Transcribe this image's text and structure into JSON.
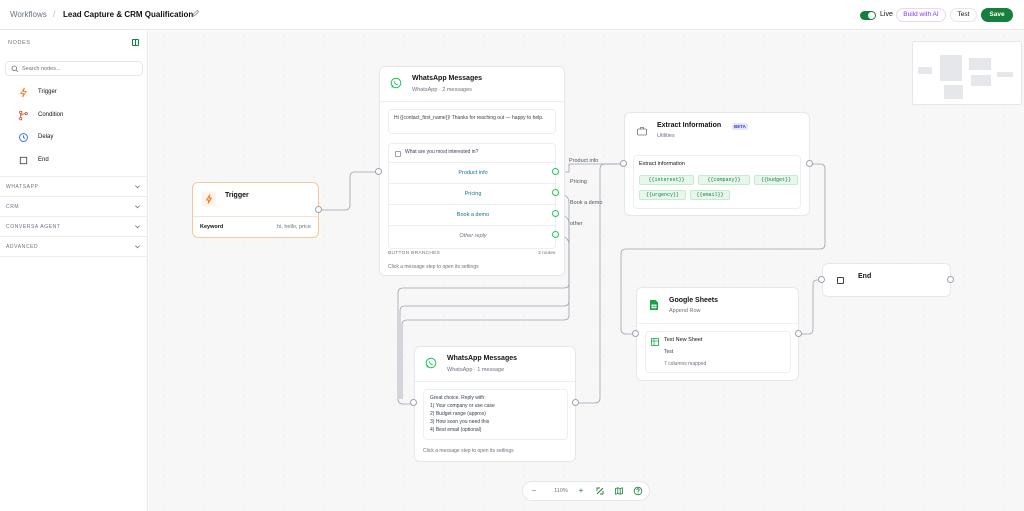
{
  "topbar": {
    "breadcrumb": "Workflows",
    "separator": "/",
    "title": "Lead Capture & CRM Qualification",
    "live_label": "Live",
    "live_on": true,
    "build_ai_label": "Build with AI",
    "test_label": "Test",
    "save_label": "Save",
    "accent_color": "#15803d"
  },
  "sidebar": {
    "heading": "NODES",
    "search_placeholder": "Search nodes...",
    "nodes": [
      {
        "label": "Trigger",
        "icon": "bolt-icon"
      },
      {
        "label": "Condition",
        "icon": "branch-icon"
      },
      {
        "label": "Delay",
        "icon": "clock-icon"
      },
      {
        "label": "End",
        "icon": "stop-icon"
      }
    ],
    "sections": [
      "WHATSAPP",
      "CRM",
      "CONVERSA AGENT",
      "ADVANCED"
    ]
  },
  "canvas": {
    "zoom": "110%",
    "trigger": {
      "title": "Trigger",
      "field_label": "Keyword",
      "field_value": "hi, hello, price"
    },
    "wa1": {
      "title": "WhatsApp Messages",
      "subtitle": "WhatsApp · 2 messages",
      "message": "Hi {{contact_first_name}}! Thanks for reaching out — happy to help.",
      "question": "What are you most interested in?",
      "options": [
        "Product info",
        "Pricing",
        "Book a demo",
        "Other reply"
      ],
      "branches_label": "BUTTON BRANCHES",
      "branches_count": "3 routes",
      "hint": "Click a message step to open its settings"
    },
    "edge_labels": [
      "Product info",
      "Pricing",
      "Book a demo",
      "other"
    ],
    "extract": {
      "title": "Extract Information",
      "beta": "BETA",
      "subtitle": "Utilities",
      "inner_title": "Extract information",
      "chips": [
        "{{interest}}",
        "{{company}}",
        "{{budget}}",
        "{{urgency}}",
        "{{email}}"
      ]
    },
    "sheets": {
      "title": "Google Sheets",
      "subtitle": "Append Row",
      "sheet_name": "Test New Sheet",
      "sheet_tab": "Test",
      "mapped": "7 columns mapped"
    },
    "end": {
      "title": "End"
    },
    "wa2": {
      "title": "WhatsApp Messages",
      "subtitle": "WhatsApp · 1 message",
      "lines": [
        "Great choice. Reply with:",
        "1) Your company or use case",
        "2) Budget range (approx)",
        "3) How soon you need this",
        "4) Best email (optional)"
      ],
      "hint": "Click a message step to open its settings"
    }
  }
}
